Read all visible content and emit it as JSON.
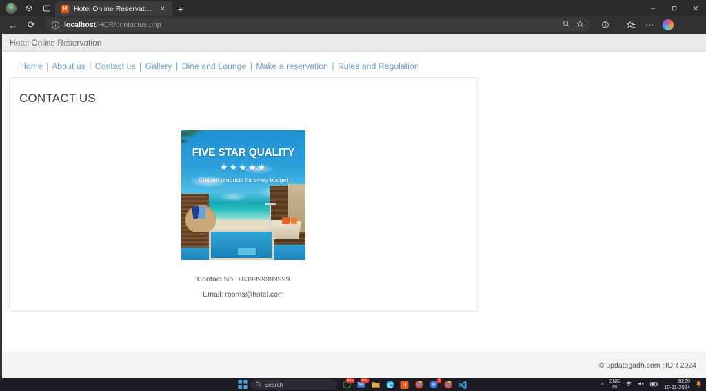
{
  "browser": {
    "tab": {
      "title": "Hotel Online Reservation",
      "favicon_glyph": "H",
      "close_label": "×"
    },
    "new_tab_label": "+",
    "left_icons": [
      "profile-avatar",
      "workspaces-icon",
      "tab-actions-icon"
    ],
    "window_controls": {
      "minimize": "—",
      "maximize": "❐",
      "close": "×"
    },
    "nav": {
      "back": "←",
      "forward": "→",
      "reload": "⟳"
    },
    "address": {
      "prefix": "localhost",
      "path": "/HOR/contactus.php",
      "info_icon": "ⓘ"
    },
    "omnibox_actions": {
      "search": "⌕",
      "favorite": "☆"
    },
    "toolbar_actions": {
      "split_screen": "⊞",
      "favorites": "☆",
      "settings": "⋯",
      "copilot": "copilot-icon"
    }
  },
  "site": {
    "header_brand": "Hotel Online Reservation",
    "nav_links": [
      "Home",
      "About us",
      "Contact us",
      "Gallery",
      "Dine and Lounge",
      "Make a reservation",
      "Rules and Regulation"
    ],
    "nav_separator": "|",
    "page_title": "CONTACT US",
    "hero": {
      "headline": "FIVE STAR QUALITY",
      "stars": "★★★★★",
      "tagline": "Custom products for every budget",
      "alt": "resort-pool-banner"
    },
    "contact": {
      "phone_label": "Contact No:",
      "phone_value": "+639999999999",
      "email_label": "Email:",
      "email_value": "rooms@hotel.com"
    },
    "footer": "© updategadh.com HOR 2024"
  },
  "taskbar": {
    "start_label": "start-icon",
    "search_placeholder": "Search",
    "search_icon": "⌕",
    "apps": [
      {
        "name": "app-whatsapp",
        "glyph": "✆",
        "badge": "99+",
        "color": "#25b24b"
      },
      {
        "name": "app-mail",
        "glyph": "✉",
        "badge": "99+",
        "color": "#3b7fd4"
      },
      {
        "name": "app-file-explorer",
        "glyph": "🗀",
        "badge": "",
        "color": "#e9b23c"
      },
      {
        "name": "app-edge",
        "glyph": "e",
        "badge": "",
        "color": "#2b9fd8"
      },
      {
        "name": "app-hotel-reservation",
        "glyph": "H",
        "badge": "",
        "color": "#e8591f"
      },
      {
        "name": "app-chrome-profile-a",
        "glyph": "◉",
        "badge": "",
        "color": "#d94a3d"
      },
      {
        "name": "app-chrome-beta",
        "glyph": "◉",
        "badge": "1",
        "color": "#4a6fd4"
      },
      {
        "name": "app-chrome-profile-b",
        "glyph": "◉",
        "badge": "",
        "color": "#d94a3d"
      },
      {
        "name": "app-vscode",
        "glyph": "✕",
        "badge": "",
        "color": "#3aa0dd"
      }
    ],
    "tray": {
      "overflow": "^",
      "language_primary": "ENG",
      "language_secondary": "IN",
      "wifi": "◈",
      "volume": "◁)",
      "battery": "▭",
      "time": "20:29",
      "date": "10-11-2024",
      "notification": "🔔"
    }
  },
  "colors": {
    "accent_link": "#6a9ad0",
    "favicon": "#e8591f",
    "header_bar": "#ebebeb",
    "page_bg": "#ffffff"
  }
}
